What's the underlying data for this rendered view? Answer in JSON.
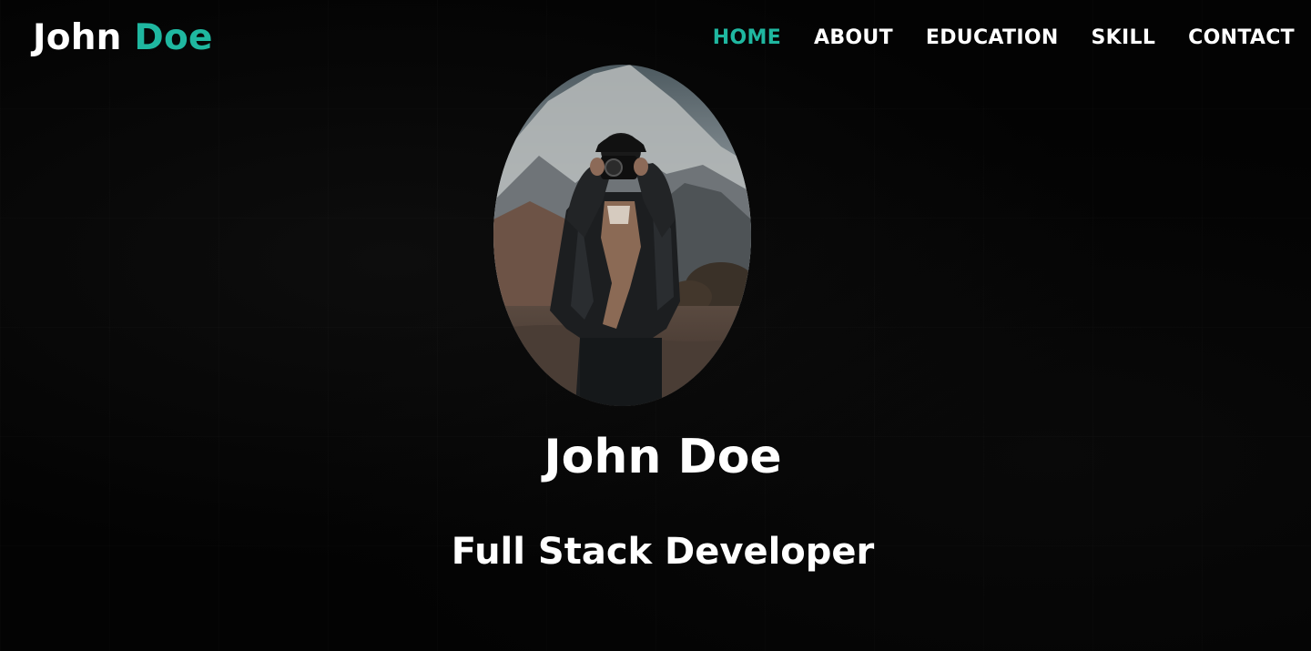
{
  "brand": {
    "first": "John",
    "last": "Doe",
    "accent_color": "#1fb7a0"
  },
  "nav": {
    "items": [
      {
        "label": "HOME",
        "active": true
      },
      {
        "label": "ABOUT",
        "active": false
      },
      {
        "label": "EDUCATION",
        "active": false
      },
      {
        "label": "SKILL",
        "active": false
      },
      {
        "label": "CONTACT",
        "active": false
      }
    ]
  },
  "hero": {
    "name": "John Doe",
    "role": "Full Stack Developer",
    "avatar_icon": "profile-photo"
  },
  "colors": {
    "background": "#030303",
    "text": "#ffffff",
    "accent": "#1fb7a0"
  }
}
